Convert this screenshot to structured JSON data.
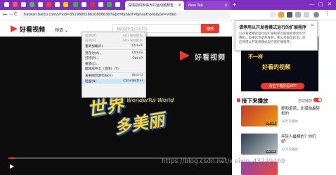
{
  "browser": {
    "tabs": [
      {
        "title": "深情前四步操大匹运动题预告",
        "active": true
      },
      {
        "title": "New Tab",
        "active": false
      }
    ],
    "new_tab_glyph": "+",
    "url": "haokan.baidu.com/v?vid=3519880286208066367&pd=bjh&fr=bjhauthor&type=video",
    "nav": {
      "back": "←",
      "forward": "→",
      "reload": "C"
    },
    "window_controls": {
      "minimize": "—",
      "maximize": "□",
      "close": "✕"
    }
  },
  "site": {
    "logo_text": "好看视频",
    "channel_label": "频道 ⌄",
    "search_placeholder": "我的前半生(22/77)",
    "search_button": "搜索",
    "accent": "#e83a2c"
  },
  "video": {
    "watermark": "好看视频",
    "art_line1": "世界",
    "art_line2": "多美丽",
    "art_sub": "Wonderful World",
    "progress": 0.03
  },
  "context_menu": {
    "items": [
      {
        "label": "返回(B)",
        "key": "Alt+向左箭头",
        "disabled": true
      },
      {
        "label": "前进(F)",
        "key": "Alt+向右箭头",
        "disabled": true
      },
      {
        "label": "重新加载(R)",
        "key": "Ctrl+R",
        "disabled": false
      },
      {
        "sep": true
      },
      {
        "label": "另存为(A)...",
        "key": "Ctrl+S",
        "disabled": false
      },
      {
        "label": "打印(P)...",
        "key": "Ctrl+P",
        "disabled": false
      },
      {
        "label": "投放(C)...",
        "key": "",
        "disabled": false
      },
      {
        "label": "翻译成中文（简体）(T)",
        "key": "",
        "disabled": false
      },
      {
        "sep": true
      },
      {
        "label": "查看网页源代码(V)",
        "key": "Ctrl+U",
        "disabled": false
      },
      {
        "label": "检查(N)",
        "key": "Ctrl+Shift+I",
        "disabled": false,
        "highlight": true
      }
    ]
  },
  "popup": {
    "title": "请停用以开发者模式运行的扩展程序",
    "body": "以开发者模式运行的扩展程序可能会损害您的计算机。如果您不是开发者，那么为安全起见，您应停用以开发者模式运行的扩展程序。",
    "close": "✕"
  },
  "sidebar": {
    "banner_lines": [
      "不一样",
      "好看的视频",
      "点击下载好看APP"
    ],
    "banner_button": "点击下载好看APP",
    "up_next_title": "接下来播放",
    "autoplay_label": "自动播放",
    "videos": [
      {
        "title": "爱和承诺，比孤独最轻松的",
        "duration": "07:01",
        "views": "18万次播放"
      },
      {
        "title": "年轻人最棒的？你们好！",
        "duration": "00:52",
        "views": "22万次播放"
      },
      {
        "title": "",
        "duration": "",
        "views": ""
      }
    ]
  },
  "watermark_text": {
    "light": "https://blog.csdn.net/w",
    "dark": "eixin_43749469"
  }
}
